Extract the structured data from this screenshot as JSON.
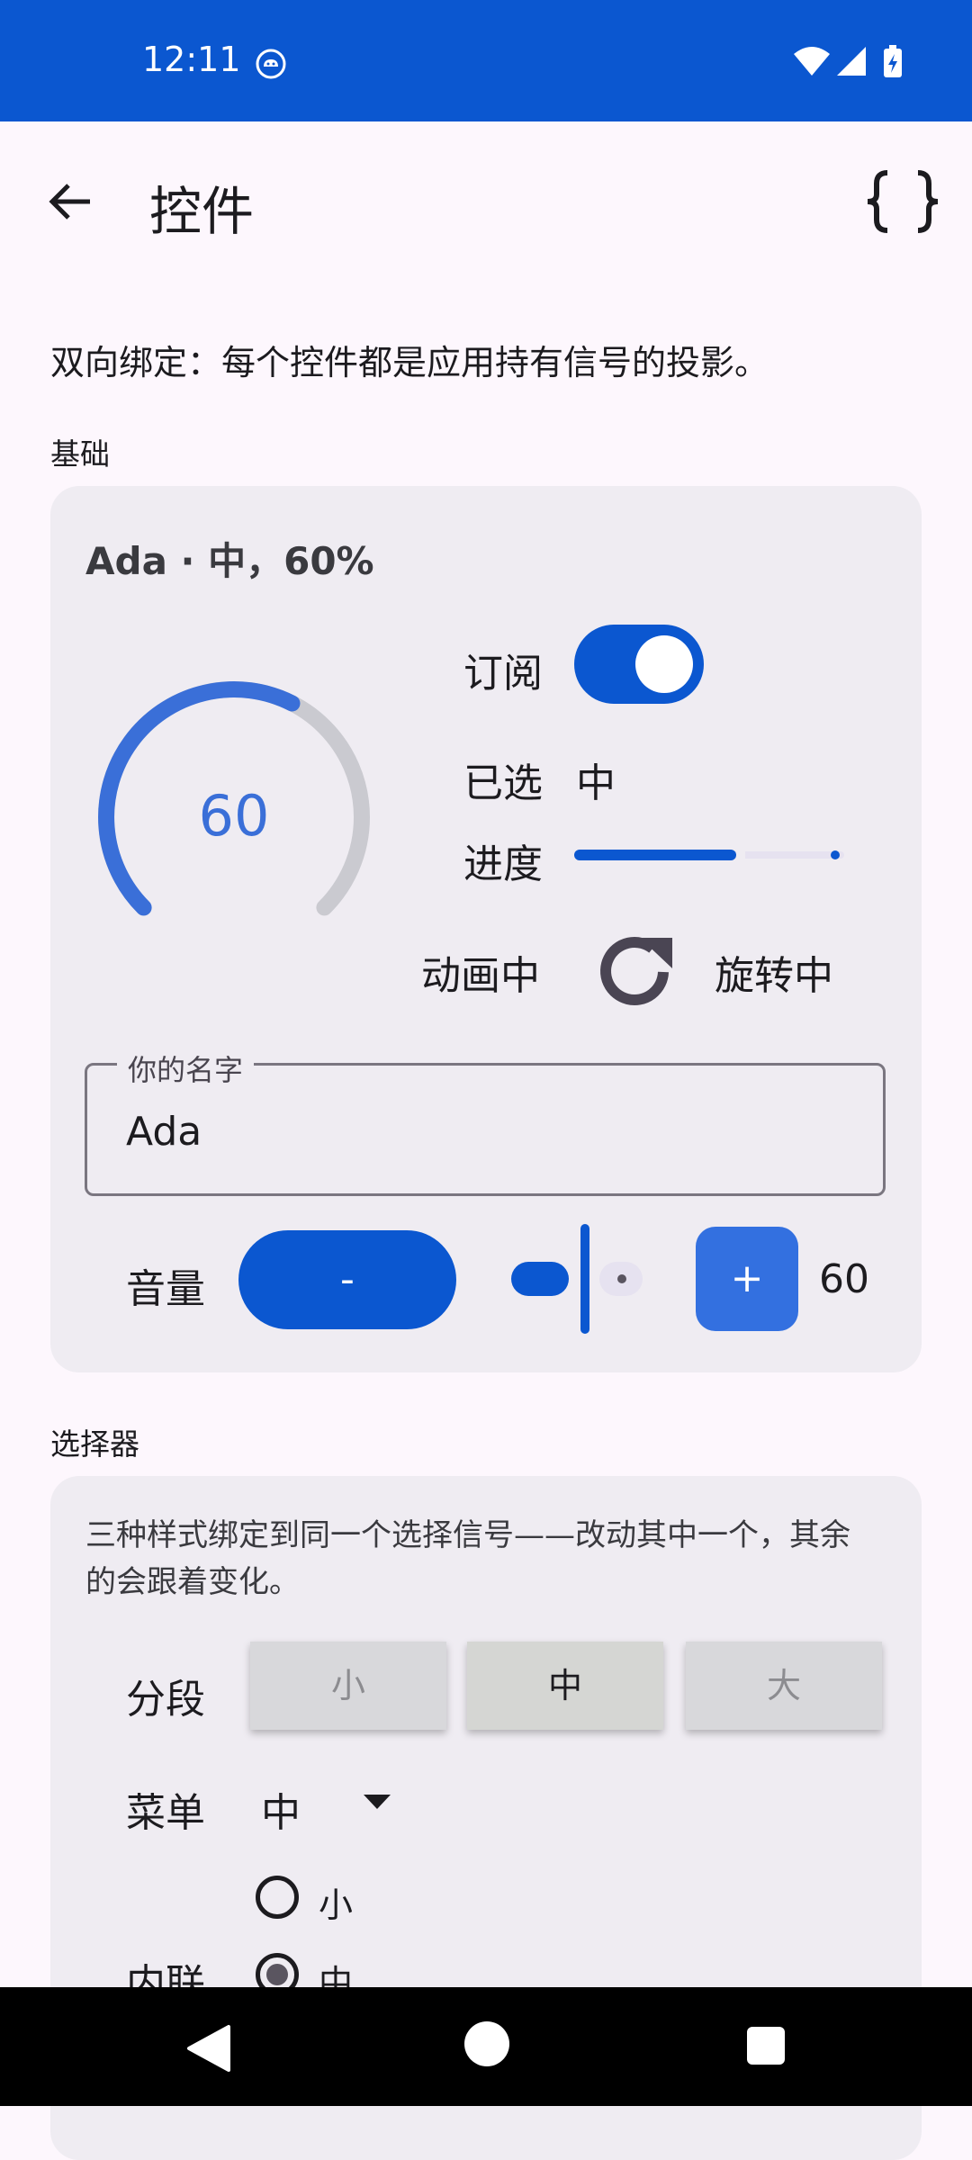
{
  "status_bar": {
    "time": "12:11"
  },
  "app_bar": {
    "title": "控件"
  },
  "subtitle": "双向绑定：每个控件都是应用持有信号的投影。",
  "basic": {
    "section_label": "基础",
    "summary": "Ada · 中，60%",
    "gauge_value": "60",
    "gauge_fraction": 0.6,
    "subscribe_label": "订阅",
    "subscribe_on": true,
    "selected_label": "已选",
    "selected_value": "中",
    "progress_label": "进度",
    "progress_fraction": 0.6,
    "animating_label": "动画中",
    "rotating_label": "旋转中",
    "name_field": {
      "label": "你的名字",
      "value": "Ada"
    },
    "volume": {
      "label": "音量",
      "minus": "-",
      "plus": "+",
      "value": "60"
    }
  },
  "picker": {
    "section_label": "选择器",
    "description": "三种样式绑定到同一个选择信号——改动其中一个，其余的会跟着变化。",
    "segment_label": "分段",
    "segments": [
      "小",
      "中",
      "大"
    ],
    "menu_label": "菜单",
    "menu_value": "中",
    "inline_label": "内联",
    "radio_options": [
      "小",
      "中"
    ],
    "selected": "中"
  },
  "colors": {
    "primary": "#0B57D0",
    "background": "#FDF7FD",
    "card": "#EFECF2",
    "gauge_value": "#3A6FD8"
  }
}
